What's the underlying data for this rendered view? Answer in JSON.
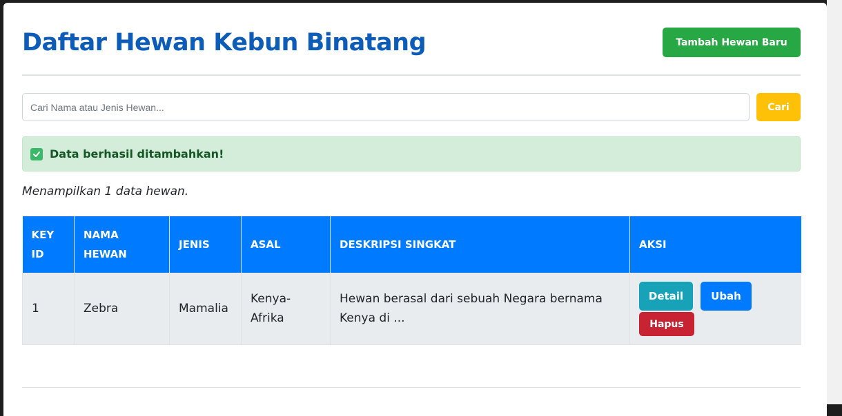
{
  "header": {
    "title": "Daftar Hewan Kebun Binatang",
    "add_button_label": "Tambah Hewan Baru"
  },
  "search": {
    "placeholder": "Cari Nama atau Jenis Hewan...",
    "value": "",
    "button_label": "Cari"
  },
  "alert": {
    "icon": "check-square-icon",
    "message": "Data berhasil ditambahkan!"
  },
  "count_text": "Menampilkan 1 data hewan.",
  "table": {
    "headers": [
      "KEY ID",
      "NAMA HEWAN",
      "JENIS",
      "ASAL",
      "DESKRIPSI SINGKAT",
      "AKSI"
    ],
    "rows": [
      {
        "key_id": "1",
        "nama": "Zebra",
        "jenis": "Mamalia",
        "asal": "Kenya-Afrika",
        "deskripsi": "Hewan berasal dari sebuah Negara bernama Kenya di ...",
        "actions": {
          "detail": "Detail",
          "edit": "Ubah",
          "delete": "Hapus"
        }
      }
    ]
  },
  "colors": {
    "title": "#0d5db8",
    "add_button": "#28a745",
    "search_button": "#ffc107",
    "alert_bg": "#d4edda",
    "alert_text": "#155724",
    "table_header": "#007bff",
    "row_bg": "#e9ecef",
    "detail_button": "#17a2b8",
    "edit_button": "#007bff",
    "delete_button": "#c82333"
  }
}
